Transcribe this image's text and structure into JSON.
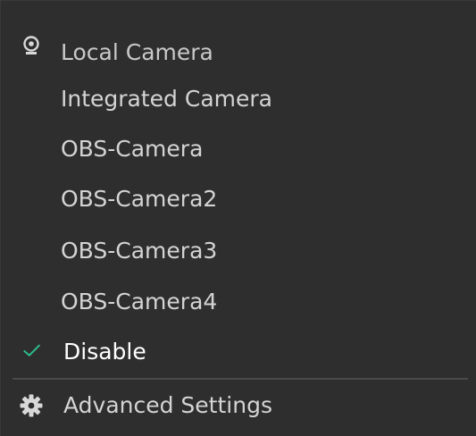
{
  "menu": {
    "header": {
      "label": "Local Camera",
      "icon": "webcam-icon"
    },
    "items": [
      {
        "label": "Integrated Camera"
      },
      {
        "label": "OBS-Camera"
      },
      {
        "label": "OBS-Camera2"
      },
      {
        "label": "OBS-Camera3"
      },
      {
        "label": "OBS-Camera4"
      },
      {
        "label": "Disable",
        "selected": true
      }
    ],
    "footer": {
      "label": "Advanced Settings",
      "icon": "gear-icon"
    }
  },
  "colors": {
    "background": "#2e2e2e",
    "text": "#d4d4d4",
    "checkmark": "#2dbd8a",
    "divider": "#4a4a4a"
  }
}
